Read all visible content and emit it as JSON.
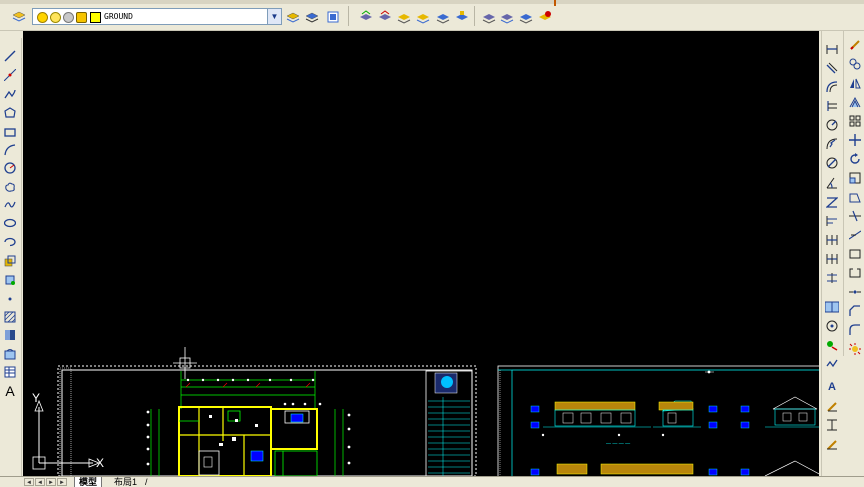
{
  "layer_toolbar": {
    "current_layer": "GROUND",
    "layer_manager_icon": "layers-icon",
    "dropdown_icon": "chevron-down-icon"
  },
  "canvas": {
    "background": "#000000",
    "ucs_x_label": "X",
    "ucs_y_label": "Y"
  },
  "layout_tabs": {
    "items": [
      {
        "label": "模型",
        "active": true
      },
      {
        "label": "布局1",
        "active": false
      }
    ],
    "divider": "/"
  },
  "left_toolbar": {
    "tools": [
      "line-icon",
      "construction-line-icon",
      "polyline-icon",
      "polygon-icon",
      "rectangle-icon",
      "arc-icon",
      "circle-icon",
      "revision-cloud-icon",
      "spline-icon",
      "ellipse-icon",
      "ellipse-arc-icon",
      "insert-block-icon",
      "make-block-icon",
      "point-icon",
      "hatch-icon",
      "gradient-icon",
      "region-icon",
      "table-icon",
      "multiline-text-icon"
    ],
    "text_tool_glyph": "A"
  },
  "right_toolbar": {
    "dimension_tools": [
      "linear-dim-icon",
      "aligned-dim-icon",
      "arc-length-icon",
      "ordinate-icon",
      "radius-icon",
      "jogged-icon",
      "diameter-icon",
      "angular-icon",
      "quick-dim-icon",
      "baseline-icon",
      "continue-icon",
      "qleader-icon",
      "tolerance-icon",
      "center-mark-icon",
      "dim-edit-icon",
      "dim-text-edit-icon",
      "dim-update-icon",
      "dim-style-icon"
    ],
    "modify_tools": [
      "erase-icon",
      "copy-icon",
      "mirror-icon",
      "offset-icon",
      "array-icon",
      "move-icon",
      "rotate-icon",
      "scale-icon",
      "stretch-icon",
      "trim-icon",
      "extend-icon",
      "break-at-point-icon",
      "break-icon",
      "join-icon",
      "chamfer-icon",
      "fillet-icon",
      "explode-icon"
    ]
  },
  "colors": {
    "ui_bg": "#ece9d8",
    "drawing_frame": "#ffffff",
    "cad_green": "#00ff00",
    "cad_yellow": "#ffff00",
    "cad_cyan": "#00ffff",
    "cad_blue": "#0000ff"
  }
}
